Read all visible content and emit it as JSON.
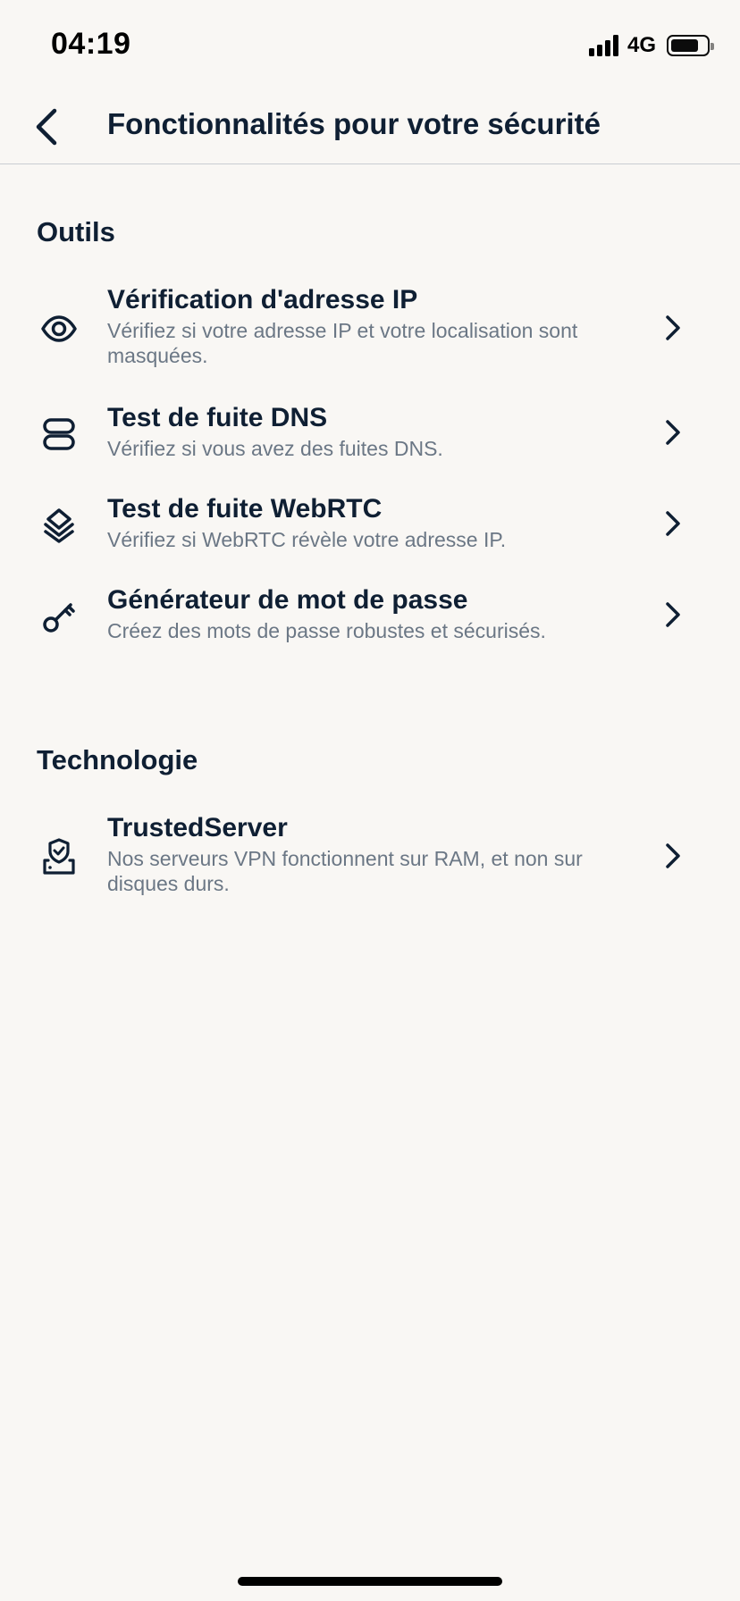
{
  "status_bar": {
    "time": "04:19",
    "network": "4G",
    "battery_level": 0.82
  },
  "header": {
    "title": "Fonctionnalités pour votre sécurité",
    "back_icon": "chevron-left-icon"
  },
  "sections": [
    {
      "title": "Outils",
      "items": [
        {
          "title": "Vérification d'adresse IP",
          "subtitle": "Vérifiez si votre adresse IP et votre localisation sont masquées.",
          "icon": "eye-icon"
        },
        {
          "title": "Test de fuite DNS",
          "subtitle": "Vérifiez si vous avez des fuites DNS.",
          "icon": "server-icon"
        },
        {
          "title": "Test de fuite WebRTC",
          "subtitle": "Vérifiez si WebRTC révèle votre adresse IP.",
          "icon": "layers-icon"
        },
        {
          "title": "Générateur de mot de passe",
          "subtitle": "Créez des mots de passe robustes et sécurisés.",
          "icon": "key-icon"
        }
      ]
    },
    {
      "title": "Technologie",
      "items": [
        {
          "title": "TrustedServer",
          "subtitle": "Nos serveurs VPN fonctionnent sur RAM,  et non sur disques durs.",
          "icon": "shield-server-icon"
        }
      ]
    }
  ],
  "colors": {
    "background": "#f9f7f4",
    "text_primary": "#0f1f33",
    "text_secondary": "#6b7785"
  }
}
